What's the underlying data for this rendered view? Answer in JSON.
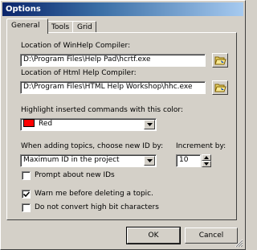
{
  "window": {
    "title": "Options"
  },
  "tabs": [
    {
      "label": "General",
      "active": true
    },
    {
      "label": "Tools",
      "active": false
    },
    {
      "label": "Grid",
      "active": false
    }
  ],
  "general": {
    "winhelp_label": "Location of WinHelp Compiler:",
    "winhelp_value": "D:\\Program Files\\Help Pad\\hcrtf.exe",
    "htmlhelp_label": "Location of Html Help Compiler:",
    "htmlhelp_value": "D:\\Program Files\\HTML Help Workshop\\hhc.exe",
    "highlight_label": "Highlight inserted commands with this color:",
    "highlight_color_name": "Red",
    "highlight_color": "#ff0000",
    "new_id_label": "When adding topics, choose new ID by:",
    "new_id_value": "Maximum ID in the project",
    "increment_label": "Increment by:",
    "increment_value": "10",
    "prompt_new_ids_label": "Prompt about new IDs",
    "prompt_new_ids_checked": false,
    "warn_delete_label": "Warn me before deleting a topic.",
    "warn_delete_checked": true,
    "no_convert_label": "Do not convert high bit characters",
    "no_convert_checked": false
  },
  "buttons": {
    "ok": "OK",
    "cancel": "Cancel"
  },
  "icons": {
    "browse": "open-folder-icon",
    "dropdown": "chevron-down-icon",
    "check": "check-icon",
    "spin_up": "arrow-up-icon",
    "spin_down": "arrow-down-icon"
  }
}
